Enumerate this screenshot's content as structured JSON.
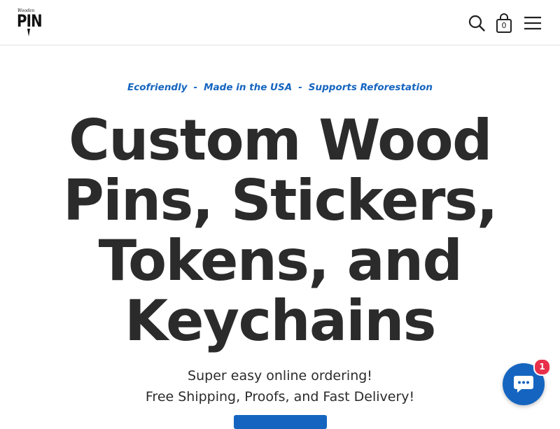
{
  "brand": {
    "logo_small": "Wooden",
    "logo_main": "PIN"
  },
  "header": {
    "icons": [
      "search-icon",
      "shopping-bag-icon",
      "menu-icon"
    ],
    "cart_count": "0"
  },
  "hero": {
    "tagline": {
      "item1": "Ecofriendly",
      "separator": "-",
      "item2": "Made in the USA",
      "item3": "Supports Reforestation"
    },
    "headline": {
      "line1": "Custom Wood",
      "line2": "Pins, Stickers,",
      "line3": "Tokens, and",
      "line4": "Keychains"
    },
    "subtext1": "Super easy online ordering!",
    "subtext2": "Free Shipping, Proofs, and Fast Delivery!"
  },
  "chat": {
    "icon": "chat-bubble-icon",
    "badge_count": "1"
  },
  "colors": {
    "accent": "#1565c0",
    "text": "#2b2b2b",
    "badge": "#e8304a",
    "border": "#e3e3e3"
  }
}
